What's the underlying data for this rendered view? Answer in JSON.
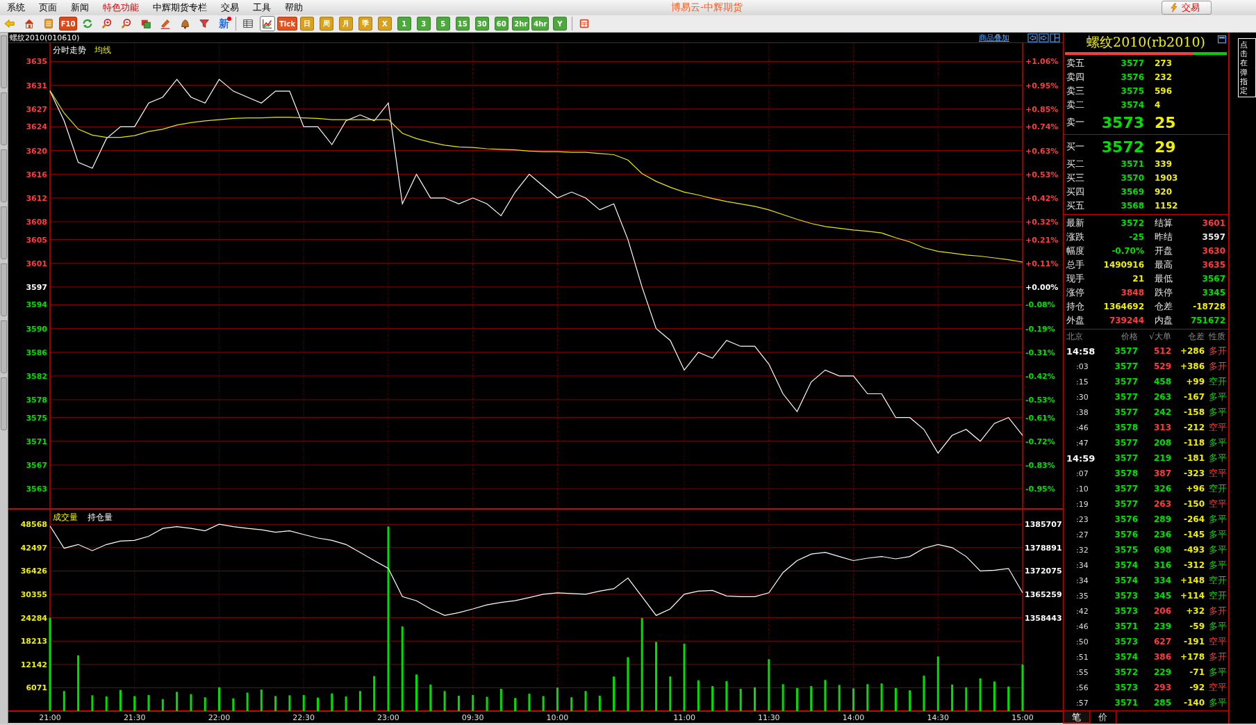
{
  "menu": {
    "items": [
      {
        "label": "系统",
        "selected": false
      },
      {
        "label": "页面",
        "selected": false
      },
      {
        "label": "新闻",
        "selected": false
      },
      {
        "label": "特色功能",
        "selected": true
      },
      {
        "label": "中辉期货专栏",
        "selected": false
      },
      {
        "label": "交易",
        "selected": false
      },
      {
        "label": "工具",
        "selected": false
      },
      {
        "label": "帮助",
        "selected": false
      }
    ],
    "title": "博易云-中辉期货",
    "trade_button": "交易"
  },
  "toolbar": [
    {
      "kind": "icon",
      "selected": false
    },
    {
      "kind": "icon",
      "selected": false
    },
    {
      "kind": "icon",
      "selected": false
    },
    {
      "kind": "text",
      "label": "F10",
      "color": "#e04818",
      "selected": false
    },
    {
      "kind": "icon",
      "selected": false
    },
    {
      "kind": "icon",
      "selected": false
    },
    {
      "kind": "icon",
      "selected": false
    },
    {
      "kind": "icon",
      "selected": false
    },
    {
      "kind": "icon",
      "selected": false
    },
    {
      "kind": "icon",
      "selected": false
    },
    {
      "kind": "icon",
      "selected": false
    },
    {
      "kind": "glyph",
      "label": "新",
      "color": "#2a6fd6",
      "selected": false
    },
    {
      "kind": "separator"
    },
    {
      "kind": "icon",
      "selected": false
    },
    {
      "kind": "icon",
      "selected": true
    },
    {
      "kind": "text",
      "label": "Tick",
      "color": "#e8501e",
      "selected": false
    },
    {
      "kind": "text",
      "label": "日",
      "color": "#d9a21c",
      "selected": false
    },
    {
      "kind": "text",
      "label": "周",
      "color": "#d9a21c",
      "selected": false
    },
    {
      "kind": "text",
      "label": "月",
      "color": "#d9a21c",
      "selected": false
    },
    {
      "kind": "text",
      "label": "季",
      "color": "#d9a21c",
      "selected": false
    },
    {
      "kind": "text",
      "label": "X",
      "color": "#d9a21c",
      "selected": false
    },
    {
      "kind": "text",
      "label": "1",
      "color": "#4caa3c",
      "selected": false
    },
    {
      "kind": "text",
      "label": "3",
      "color": "#4caa3c",
      "selected": false
    },
    {
      "kind": "text",
      "label": "5",
      "color": "#4caa3c",
      "selected": false
    },
    {
      "kind": "text",
      "label": "15",
      "color": "#4caa3c",
      "selected": false
    },
    {
      "kind": "text",
      "label": "30",
      "color": "#4caa3c",
      "selected": false
    },
    {
      "kind": "text",
      "label": "60",
      "color": "#4caa3c",
      "selected": false
    },
    {
      "kind": "text",
      "label": "2hr",
      "color": "#4caa3c",
      "selected": false
    },
    {
      "kind": "text",
      "label": "4hr",
      "color": "#4caa3c",
      "selected": false
    },
    {
      "kind": "text",
      "label": "Y",
      "color": "#4caa3c",
      "selected": false
    },
    {
      "kind": "separator"
    },
    {
      "kind": "icon",
      "selected": false
    }
  ],
  "chart_header": {
    "symbol": "螺纹2010(010610)",
    "overlay_link": "商品叠加"
  },
  "price_panel": {
    "chart_data": {
      "type": "line",
      "title": "分时走势",
      "grid": true,
      "categories": [
        null,
        null,
        null,
        null,
        null,
        null,
        null,
        null,
        null,
        null,
        null,
        null,
        null,
        null,
        null,
        null,
        null,
        null,
        null,
        null,
        null,
        null,
        null,
        null,
        null,
        null,
        null,
        null,
        null,
        null,
        null,
        null,
        null,
        null,
        null,
        null,
        null,
        null,
        null,
        null,
        null,
        null,
        null,
        null,
        null,
        null,
        null,
        null,
        null,
        null,
        null,
        null,
        null,
        null,
        null,
        null,
        null,
        null,
        null,
        null,
        null,
        null,
        null,
        null,
        null,
        null,
        null,
        null,
        null,
        null
      ],
      "ylim": [
        3559.5,
        3638.1
      ],
      "yticks": [
        3635,
        3631,
        3627,
        3624,
        3620,
        3616,
        3612,
        3608,
        3605,
        3601,
        3597,
        3594,
        3590,
        3586,
        3582,
        3578,
        3575,
        3571,
        3567,
        3563
      ],
      "series": [
        {
          "color": "#ffffff",
          "values": [
            3630,
            3625,
            3618,
            3617,
            3622,
            3624,
            3624,
            3628,
            3629,
            3632,
            3629,
            3628,
            3632,
            3630,
            3629,
            3628,
            3630,
            3630,
            3624,
            3624,
            3621,
            3625,
            3626,
            3625,
            3628,
            3611,
            3616,
            3612,
            3612,
            3611,
            3612,
            3611,
            3609,
            3613,
            3616,
            3614,
            3612,
            3613,
            3612,
            3610,
            3611,
            3605,
            3597,
            3590,
            3588,
            3583,
            3586,
            3585,
            3588,
            3587,
            3587,
            3584,
            3579,
            3576,
            3581,
            3583,
            3582,
            3582,
            3579,
            3579,
            3575,
            3575,
            3573,
            3569,
            3572,
            3573,
            3571,
            3574,
            3575,
            3572
          ]
        },
        {
          "name": "均线",
          "color": "#e8e800",
          "values": [
            3630.1,
            3626.3,
            3623.6,
            3622.6,
            3622.2,
            3622.2,
            3622.5,
            3623.2,
            3623.6,
            3624.3,
            3624.7,
            3625.0,
            3625.2,
            3625.4,
            3625.5,
            3625.5,
            3625.6,
            3625.6,
            3625.5,
            3625.4,
            3625.2,
            3625.2,
            3625.2,
            3625.2,
            3625.2,
            3622.9,
            3622.0,
            3621.4,
            3620.9,
            3620.6,
            3620.5,
            3620.3,
            3620.2,
            3620.1,
            3619.9,
            3619.8,
            3619.8,
            3619.7,
            3619.7,
            3619.5,
            3619.3,
            3618.4,
            3616.1,
            3614.8,
            3613.8,
            3613.0,
            3612.5,
            3611.9,
            3611.4,
            3611.0,
            3610.6,
            3610.0,
            3609.2,
            3608.4,
            3607.7,
            3607.2,
            3606.9,
            3606.6,
            3606.4,
            3606.1,
            3605.3,
            3604.6,
            3603.6,
            3603.0,
            3602.7,
            3602.4,
            3602.2,
            3601.9,
            3601.6,
            3601.2
          ]
        }
      ]
    },
    "right_axis": [
      {
        "label": "+1.06%",
        "kind": "up"
      },
      {
        "label": "+0.95%",
        "kind": "up"
      },
      {
        "label": "+0.85%",
        "kind": "up"
      },
      {
        "label": "+0.74%",
        "kind": "up"
      },
      {
        "label": "+0.63%",
        "kind": "up"
      },
      {
        "label": "+0.53%",
        "kind": "up"
      },
      {
        "label": "+0.42%",
        "kind": "up"
      },
      {
        "label": "+0.32%",
        "kind": "up"
      },
      {
        "label": "+0.21%",
        "kind": "up"
      },
      {
        "label": "+0.11%",
        "kind": "up"
      },
      {
        "label": "+0.00%",
        "kind": "flat"
      },
      {
        "label": "-0.08%",
        "kind": "down"
      },
      {
        "label": "-0.19%",
        "kind": "down"
      },
      {
        "label": "-0.31%",
        "kind": "down"
      },
      {
        "label": "-0.42%",
        "kind": "down"
      },
      {
        "label": "-0.53%",
        "kind": "down"
      },
      {
        "label": "-0.61%",
        "kind": "down"
      },
      {
        "label": "-0.72%",
        "kind": "down"
      },
      {
        "label": "-0.83%",
        "kind": "down"
      },
      {
        "label": "-0.95%",
        "kind": "down"
      }
    ]
  },
  "volume_panel": {
    "chart_data": {
      "type": "bar",
      "title": "成交量",
      "grid": true,
      "categories": [
        "21:00",
        null,
        null,
        null,
        null,
        null,
        "21:30",
        null,
        null,
        null,
        null,
        null,
        "22:00",
        null,
        null,
        null,
        null,
        null,
        "22:30",
        null,
        null,
        null,
        null,
        null,
        "23:00",
        null,
        null,
        null,
        null,
        null,
        "09:30",
        null,
        null,
        null,
        null,
        null,
        "10:00",
        null,
        null,
        null,
        null,
        null,
        null,
        null,
        null,
        "11:00",
        null,
        null,
        null,
        null,
        null,
        "11:30",
        null,
        null,
        null,
        null,
        null,
        "14:00",
        null,
        null,
        null,
        null,
        null,
        "14:30",
        null,
        null,
        null,
        null,
        null,
        "15:00"
      ],
      "ylim": [
        0,
        52400
      ],
      "yticks": [
        48568,
        42497,
        36426,
        30355,
        24284,
        18213,
        12142,
        6071
      ],
      "series": [
        {
          "color": "#00e000",
          "values": [
            24300,
            5200,
            14500,
            4100,
            3800,
            5500,
            3900,
            4200,
            3100,
            5000,
            4400,
            3600,
            6200,
            3300,
            4800,
            5600,
            3900,
            4100,
            4200,
            3500,
            4600,
            3800,
            5200,
            9100,
            48000,
            22000,
            9500,
            6900,
            5200,
            4000,
            4200,
            3700,
            5800,
            3400,
            4500,
            3900,
            6100,
            3600,
            5200,
            4000,
            9000,
            14000,
            24200,
            18000,
            9000,
            17500,
            8000,
            6500,
            7800,
            5800,
            6200,
            13500,
            7000,
            6000,
            6500,
            8100,
            6800,
            5900,
            7000,
            7200,
            6000,
            5400,
            9200,
            14200,
            6900,
            6200,
            8500,
            7700,
            6400,
            12100
          ]
        }
      ]
    },
    "open_interest": {
      "chart_data": {
        "type": "line",
        "title": "持仓量",
        "ylim": [
          1358443,
          1385707
        ],
        "categories": [
          null,
          null,
          null,
          null,
          null,
          null,
          null,
          null,
          null,
          null,
          null,
          null,
          null,
          null,
          null,
          null,
          null,
          null,
          null,
          null,
          null,
          null,
          null,
          null,
          null,
          null,
          null,
          null,
          null,
          null,
          null,
          null,
          null,
          null,
          null,
          null,
          null,
          null,
          null,
          null,
          null,
          null,
          null,
          null,
          null,
          null,
          null,
          null,
          null,
          null,
          null,
          null,
          null,
          null,
          null,
          null,
          null,
          null,
          null,
          null,
          null,
          null,
          null,
          null,
          null,
          null,
          null,
          null,
          null,
          null
        ],
        "yticks": [
          1385707,
          1378891,
          1372075,
          1365259,
          1358443
        ],
        "series": [
          {
            "color": "#ffffff",
            "values": [
              1385200,
              1378700,
              1379800,
              1378000,
              1379800,
              1380800,
              1381000,
              1382200,
              1384500,
              1385000,
              1384500,
              1383800,
              1385700,
              1385000,
              1384500,
              1384100,
              1383400,
              1383800,
              1382700,
              1381700,
              1381000,
              1379800,
              1377500,
              1375100,
              1372800,
              1364600,
              1363400,
              1361000,
              1359100,
              1359900,
              1361000,
              1362200,
              1362900,
              1363400,
              1364300,
              1365300,
              1365700,
              1365500,
              1365300,
              1366200,
              1366900,
              1370000,
              1364600,
              1359100,
              1361000,
              1365300,
              1366200,
              1366400,
              1364800,
              1364600,
              1364600,
              1365700,
              1371600,
              1375100,
              1377000,
              1377500,
              1376300,
              1375100,
              1375800,
              1376300,
              1375600,
              1376300,
              1378700,
              1379800,
              1378900,
              1376300,
              1372100,
              1372300,
              1372800,
              1365700
            ]
          }
        ]
      }
    }
  },
  "quote": {
    "title": "螺纹2010(rb2010)",
    "buy_ratio": {
      "level": 0.79
    },
    "asks": [
      {
        "label": "卖五",
        "price": "3577",
        "volume": "273"
      },
      {
        "label": "卖四",
        "price": "3576",
        "volume": "232"
      },
      {
        "label": "卖三",
        "price": "3575",
        "volume": "596"
      },
      {
        "label": "卖二",
        "price": "3574",
        "volume": "4"
      },
      {
        "label": "卖一",
        "price": "3573",
        "volume": "25"
      }
    ],
    "bids": [
      {
        "label": "买一",
        "price": "3572",
        "volume": "29"
      },
      {
        "label": "买二",
        "price": "3571",
        "volume": "339"
      },
      {
        "label": "买三",
        "price": "3570",
        "volume": "1903"
      },
      {
        "label": "买四",
        "price": "3569",
        "volume": "920"
      },
      {
        "label": "买五",
        "price": "3568",
        "volume": "1152"
      }
    ],
    "stats": [
      {
        "label": "最新",
        "value": "3572",
        "color": "#00e000"
      },
      {
        "label": "结算",
        "value": "3601",
        "color": "#ff3c3c"
      },
      {
        "label": "涨跌",
        "value": "-25",
        "color": "#00e000"
      },
      {
        "label": "昨结",
        "value": "3597",
        "color": "#e8e8e8"
      },
      {
        "label": "幅度",
        "value": "-0.70%",
        "color": "#00e000"
      },
      {
        "label": "开盘",
        "value": "3630",
        "color": "#ff3c3c"
      },
      {
        "label": "总手",
        "value": "1490916",
        "color": "#f0f000"
      },
      {
        "label": "最高",
        "value": "3635",
        "color": "#ff3c3c"
      },
      {
        "label": "现手",
        "value": "21",
        "color": "#f0f000"
      },
      {
        "label": "最低",
        "value": "3567",
        "color": "#00e000"
      },
      {
        "label": "涨停",
        "value": "3848",
        "color": "#ff3c3c"
      },
      {
        "label": "跌停",
        "value": "3345",
        "color": "#00e000"
      },
      {
        "label": "持仓",
        "value": "1364692",
        "color": "#f0f000"
      },
      {
        "label": "仓差",
        "value": "-18728",
        "color": "#f0f000"
      },
      {
        "label": "外盘",
        "value": "739244",
        "color": "#ff3c3c"
      },
      {
        "label": "内盘",
        "value": "751672",
        "color": "#00e000"
      }
    ],
    "ticks": {
      "columns": [
        "北京",
        "价格",
        "√大单",
        "仓差",
        "性质"
      ],
      "rows": [
        {
          "time": "14:58",
          "kind": "minute",
          "price": "3577",
          "volume": "512",
          "oi_change": "+286",
          "nature": "多开",
          "color": "#ff3c3c"
        },
        {
          "time": ":03",
          "kind": "second",
          "price": "3577",
          "volume": "529",
          "oi_change": "+386",
          "nature": "多开",
          "color": "#ff3c3c"
        },
        {
          "time": ":15",
          "kind": "second",
          "price": "3577",
          "volume": "458",
          "oi_change": "+99",
          "nature": "空开",
          "color": "#00e000"
        },
        {
          "time": ":30",
          "kind": "second",
          "price": "3577",
          "volume": "263",
          "oi_change": "-167",
          "nature": "多平",
          "color": "#00e000"
        },
        {
          "time": ":38",
          "kind": "second",
          "price": "3577",
          "volume": "242",
          "oi_change": "-158",
          "nature": "多平",
          "color": "#00e000"
        },
        {
          "time": ":46",
          "kind": "second",
          "price": "3578",
          "volume": "313",
          "oi_change": "-212",
          "nature": "空平",
          "color": "#ff3c3c"
        },
        {
          "time": ":47",
          "kind": "second",
          "price": "3577",
          "volume": "208",
          "oi_change": "-118",
          "nature": "多平",
          "color": "#00e000"
        },
        {
          "time": "14:59",
          "kind": "minute",
          "price": "3577",
          "volume": "219",
          "oi_change": "-181",
          "nature": "多平",
          "color": "#00e000"
        },
        {
          "time": ":07",
          "kind": "second",
          "price": "3578",
          "volume": "387",
          "oi_change": "-323",
          "nature": "空平",
          "color": "#ff3c3c"
        },
        {
          "time": ":10",
          "kind": "second",
          "price": "3577",
          "volume": "326",
          "oi_change": "+96",
          "nature": "空开",
          "color": "#00e000"
        },
        {
          "time": ":19",
          "kind": "second",
          "price": "3577",
          "volume": "263",
          "oi_change": "-150",
          "nature": "空平",
          "color": "#ff3c3c"
        },
        {
          "time": ":23",
          "kind": "second",
          "price": "3576",
          "volume": "289",
          "oi_change": "-264",
          "nature": "多平",
          "color": "#00e000"
        },
        {
          "time": ":27",
          "kind": "second",
          "price": "3576",
          "volume": "236",
          "oi_change": "-145",
          "nature": "多平",
          "color": "#00e000"
        },
        {
          "time": ":32",
          "kind": "second",
          "price": "3575",
          "volume": "698",
          "oi_change": "-493",
          "nature": "多平",
          "color": "#00e000"
        },
        {
          "time": ":34",
          "kind": "second",
          "price": "3574",
          "volume": "316",
          "oi_change": "-312",
          "nature": "多平",
          "color": "#00e000"
        },
        {
          "time": ":34",
          "kind": "second",
          "price": "3574",
          "volume": "334",
          "oi_change": "+148",
          "nature": "空开",
          "color": "#00e000"
        },
        {
          "time": ":35",
          "kind": "second",
          "price": "3573",
          "volume": "345",
          "oi_change": "+114",
          "nature": "空开",
          "color": "#00e000"
        },
        {
          "time": ":42",
          "kind": "second",
          "price": "3573",
          "volume": "206",
          "oi_change": "+32",
          "nature": "多开",
          "color": "#ff3c3c"
        },
        {
          "time": ":46",
          "kind": "second",
          "price": "3571",
          "volume": "239",
          "oi_change": "-59",
          "nature": "多平",
          "color": "#00e000"
        },
        {
          "time": ":50",
          "kind": "second",
          "price": "3573",
          "volume": "627",
          "oi_change": "-191",
          "nature": "空平",
          "color": "#ff3c3c"
        },
        {
          "time": ":51",
          "kind": "second",
          "price": "3574",
          "volume": "386",
          "oi_change": "+178",
          "nature": "多开",
          "color": "#ff3c3c"
        },
        {
          "time": ":55",
          "kind": "second",
          "price": "3572",
          "volume": "229",
          "oi_change": "-71",
          "nature": "多平",
          "color": "#00e000"
        },
        {
          "time": ":56",
          "kind": "second",
          "price": "3573",
          "volume": "293",
          "oi_change": "-92",
          "nature": "空平",
          "color": "#ff3c3c"
        },
        {
          "time": ":57",
          "kind": "second",
          "price": "3571",
          "volume": "285",
          "oi_change": "-140",
          "nature": "多平",
          "color": "#00e000"
        }
      ]
    },
    "tabs": [
      {
        "label": "笔",
        "selected": true
      },
      {
        "label": "价",
        "selected": false
      }
    ]
  },
  "side_note": "点击在弹指定"
}
